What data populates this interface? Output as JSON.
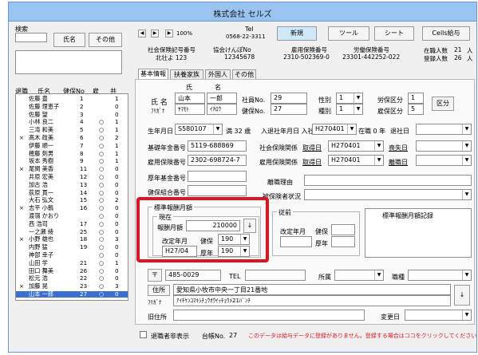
{
  "window": {
    "title": "株式会社 セルズ"
  },
  "left": {
    "search_label": "検索",
    "search_value": "",
    "name_button": "氏名",
    "other_button": "その他",
    "headers": {
      "retire": "退職",
      "name": "氏名",
      "health_no": "健保No",
      "emp": "雇",
      "share": "共"
    },
    "employees": [
      {
        "x": "",
        "name": "佐藤 豊",
        "no": "1",
        "emp": "",
        "share": "1"
      },
      {
        "x": "",
        "name": "佐藤 理恵子",
        "no": "2",
        "emp": "",
        "share": "0"
      },
      {
        "x": "",
        "name": "佐藤 望",
        "no": "3",
        "emp": "",
        "share": "0"
      },
      {
        "x": "",
        "name": "小林 良二",
        "no": "4",
        "emp": "○",
        "share": "1"
      },
      {
        "x": "",
        "name": "三滝 和美",
        "no": "5",
        "emp": "○",
        "share": "1"
      },
      {
        "x": "×",
        "name": "髙木 政美",
        "no": "6",
        "emp": "○",
        "share": "2"
      },
      {
        "x": "",
        "name": "伊藤 順一",
        "no": "7",
        "emp": "○",
        "share": "1"
      },
      {
        "x": "",
        "name": "穂藤 剣男",
        "no": "8",
        "emp": "○",
        "share": "1"
      },
      {
        "x": "",
        "name": "坂本 秀樹",
        "no": "9",
        "emp": "○",
        "share": "1"
      },
      {
        "x": "×",
        "name": "尾関 美香",
        "no": "11",
        "emp": "○",
        "share": "0"
      },
      {
        "x": "",
        "name": "井原 宏美",
        "no": "12",
        "emp": "○",
        "share": "0"
      },
      {
        "x": "",
        "name": "加古 浩",
        "no": "13",
        "emp": "○",
        "share": "0"
      },
      {
        "x": "",
        "name": "荻原 貫一",
        "no": "14",
        "emp": "○",
        "share": "0"
      },
      {
        "x": "",
        "name": "大石 弘文",
        "no": "15",
        "emp": "○",
        "share": "2"
      },
      {
        "x": "×",
        "name": "志平 小鶴",
        "no": "16",
        "emp": "○",
        "share": "0"
      },
      {
        "x": "",
        "name": "渡嶺 かおり",
        "no": "",
        "emp": "○",
        "share": "0"
      },
      {
        "x": "",
        "name": "西 浩司",
        "no": "17",
        "emp": "○",
        "share": "0"
      },
      {
        "x": "",
        "name": "一之瀬 綾",
        "no": "25",
        "emp": "○",
        "share": "0"
      },
      {
        "x": "×",
        "name": "小野 雄也",
        "no": "18",
        "emp": "○",
        "share": "3"
      },
      {
        "x": "",
        "name": "内野 猛",
        "no": "19",
        "emp": "○",
        "share": "0"
      },
      {
        "x": "",
        "name": "神部 幸子",
        "no": "",
        "emp": "○",
        "share": "0"
      },
      {
        "x": "",
        "name": "山田 学",
        "no": "21",
        "emp": "○",
        "share": "1"
      },
      {
        "x": "",
        "name": "田口 舞美",
        "no": "26",
        "emp": "○",
        "share": "0"
      },
      {
        "x": "",
        "name": "松元 浩",
        "no": "22",
        "emp": "○",
        "share": "0"
      },
      {
        "x": "×",
        "name": "加藤 晃",
        "no": "23",
        "emp": "○",
        "share": "3"
      },
      {
        "x": "",
        "name": "山本 一郎",
        "no": "27",
        "emp": "○",
        "share": "0"
      }
    ]
  },
  "toolbar": {
    "zoom": "100%",
    "tel_label": "Tel",
    "tel_value": "0568-22-3311",
    "new_button": "新規",
    "tool_button": "ツール",
    "sheet_button": "シート",
    "cells_button": "Cells給与"
  },
  "company": {
    "social_ins_label": "社会保険記号番号",
    "social_ins_value": "北壮よ 123",
    "kyokai_label": "協会けんぽNo",
    "kyokai_value": "12345678",
    "employment_label": "雇用保険番号",
    "employment_value": "2310-502369-0",
    "labor_label": "労働保険番号",
    "labor_value": "23301-442252-022",
    "enrolled_label": "在職人数",
    "enrolled_value": "21",
    "enrolled_unit": "人",
    "registered_label": "登録人数",
    "registered_value": "26",
    "registered_unit": "人"
  },
  "tabs": [
    "基本情報",
    "扶養家族",
    "外国人",
    "その他"
  ],
  "form": {
    "name_label": "氏 名",
    "kana_label": "ﾌﾘｶﾞﾅ",
    "sei_label": "氏",
    "mei_label": "名",
    "sei": "山本",
    "mei": "一郎",
    "sei_kana": "ﾔﾏﾓﾄ",
    "mei_kana": "ｲﾁﾛｳ",
    "emp_no_label": "社員No.",
    "emp_no": "29",
    "health_no_label": "健保No.",
    "health_no": "27",
    "gender_label": "性別",
    "gender": "1",
    "type_label": "種別",
    "type": "1",
    "labor_div_label": "労保区分",
    "labor_div": "1",
    "emp_div_label": "雇保区分",
    "emp_div": "5",
    "div_button": "区分",
    "birth_label": "生年月日",
    "birth": "S580107",
    "age": "満 32 歳",
    "join_label": "入退社年月日 入社",
    "join": "H270401",
    "tenure": "在職 0 年",
    "retire_label": "退社日",
    "retire": "",
    "pension_label": "基礎年金番号",
    "pension": "5119-688869",
    "social_label": "社会保険関係",
    "social_acq": "取得日",
    "social_date": "H270401",
    "social_loss": "喪失日",
    "emp_ins_label": "雇用保険番号",
    "emp_ins": "2302-698724-7",
    "emp_rel_label": "雇用保険関係",
    "emp_acq": "取得日",
    "emp_date": "H270401",
    "emp_leave": "離職日",
    "welfare_label": "厚年基金番号",
    "leave_reason_label": "離職理由",
    "health_union_label": "健保組合番号",
    "insured_status_label": "被保険者状況"
  },
  "salary": {
    "group_label": "標準報酬月額",
    "current_label": "現在",
    "monthly_label": "報酬月額",
    "monthly_value": "210000",
    "revise_label": "改定年月",
    "health_label": "健保",
    "health_value": "190",
    "revise_value": "H27/04",
    "pension_label": "厚年",
    "pension_value": "190",
    "prev_label": "従前",
    "prev_revise_label": "改定年月",
    "prev_health_label": "健保",
    "prev_pension_label": "厚年",
    "record_label": "標準報酬月額記録"
  },
  "address": {
    "zip_icon": "〒",
    "zip": "485-0029",
    "tel_label": "TEL",
    "affiliation_label": "所属",
    "position_label": "職種",
    "address_button": "住所",
    "address": "愛知県小牧市中央一丁目21番地",
    "address_kana_label": "ﾌﾘｶﾞﾅ",
    "address_kana": "ｱｲﾁｹﾝｺﾏｷｼﾁｭｳｵｳｲｯﾁｮｳﾒ21ﾊﾞﾝﾁ",
    "old_address_label": "旧住所",
    "change_date_label": "変更日"
  },
  "footer": {
    "hide_retired_label": "退職者非表示",
    "ledger_label": "台帳No.",
    "ledger_value": "27",
    "message": "このデータは給与データに登録がありません。登録する場合はココをクリックしてください"
  }
}
